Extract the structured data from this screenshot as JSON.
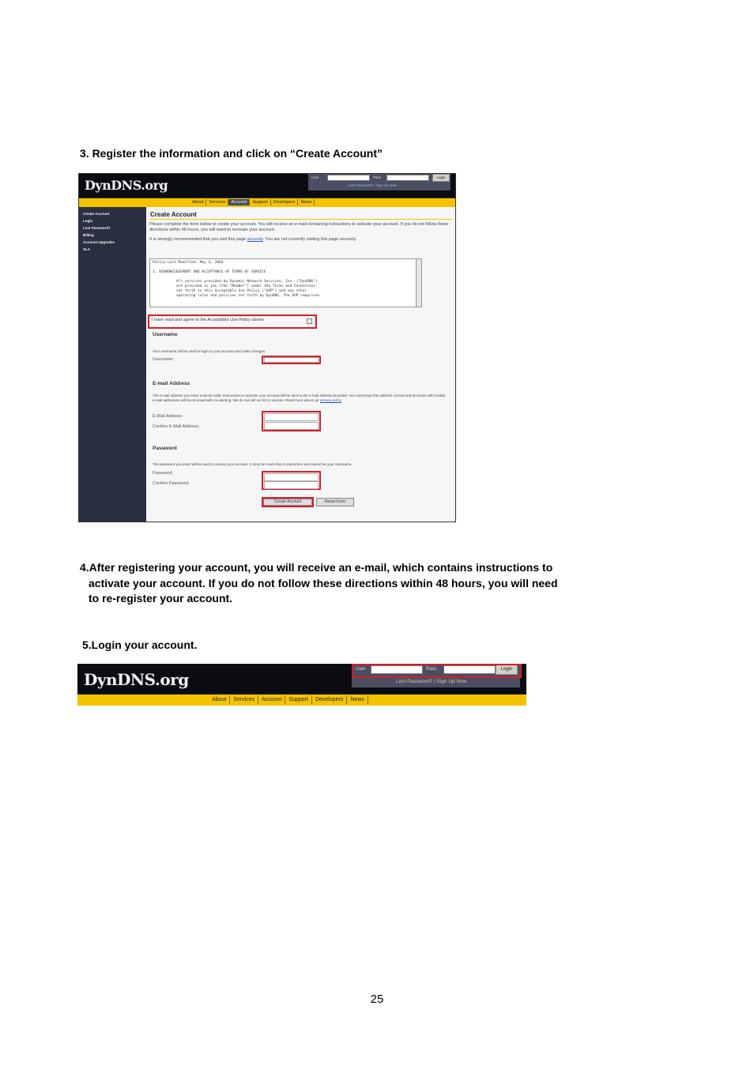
{
  "step3": {
    "text": "3. Register the information and click on “Create Account”"
  },
  "step4": {
    "lines": [
      "4.After registering your account, you will receive an e-mail, which contains instructions to",
      "activate your account. If you do not follow these directions within 48 hours, you will need",
      "to re-register your account."
    ]
  },
  "step5": {
    "text": "5.Login your account."
  },
  "page_number": "25",
  "colors": {
    "nav_yellow": "#f4c300",
    "header_black": "#0b0c12",
    "sidebar_navy": "#2b2f42",
    "highlight_red": "#d41e2a"
  },
  "screenshot1": {
    "logo": "DynDNS.org",
    "login": {
      "user_label": "User",
      "pass_label": "Pass",
      "login_button": "Login",
      "links": "Lost Password? | Sign Up Now"
    },
    "nav_tabs": [
      {
        "label": "About",
        "active": false
      },
      {
        "label": "Services",
        "active": false
      },
      {
        "label": "Account",
        "active": true
      },
      {
        "label": "Support",
        "active": false
      },
      {
        "label": "Developers",
        "active": false
      },
      {
        "label": "News",
        "active": false
      }
    ],
    "sidebar": [
      "Create Account",
      "Login",
      "Lost Password?",
      "Billing",
      "Account Upgrades",
      "SLA"
    ],
    "page_title": "Create Account",
    "intro": "Please complete the form below to create your account. You will receive an e-mail containing instructions to activate your account. If you do not follow these directions within 48 hours, you will need to recreate your account.",
    "secure_note": {
      "before": "It is strongly recommended that you visit this page ",
      "link": "securely",
      "after": ". You are not currently visiting this page securely."
    },
    "tos_lines": [
      "Policy Last Modified: May 4, 2004",
      "1. ACKNOWLEDGEMENT AND ACCEPTANCE OF TERMS OF SERVICE",
      "All services provided by Dynamic Network Services, Inc. (\"DynDNS\")",
      "are provided to you (the \"Member\") under the Terms and Conditions",
      "set forth in this Acceptable Use Policy (\"AUP\") and any other",
      "operating rules and policies set forth by DynDNS.  The AUP comprises"
    ],
    "agree": "I have read and agree to the Acceptable Use Policy above:",
    "username": {
      "heading": "Username",
      "desc": "Your username will be used to login to your account and make changes.",
      "label": "Username:"
    },
    "email": {
      "heading": "E-mail Address",
      "desc": "The e-mail address you enter must be valid. Instructions to activate your account will be sent to the e-mail address provided. You must keep this address current and accounts with invalid e-mail addresses will be removed with no warning. We do not sell our list to anyone. Read more about our",
      "link": "privacy policy",
      "label": "E-Mail Address:",
      "confirm_label": "Confirm E-Mail Address:"
    },
    "password": {
      "heading": "Password",
      "desc": "The password you enter will be used to access your account. It must be more than 5 characters and cannot be your username.",
      "label": "Password:",
      "confirm_label": "Confirm Password:"
    },
    "buttons": {
      "create": "Create Account",
      "reset": "Reset Form"
    }
  },
  "screenshot2": {
    "logo": "DynDNS.org",
    "login": {
      "user_label": "User",
      "pass_label": "Pass",
      "login_button": "Login",
      "links": "Lost Password? | Sign Up Now"
    },
    "nav_tabs": [
      "About",
      "Services",
      "Account",
      "Support",
      "Developers",
      "News"
    ]
  }
}
